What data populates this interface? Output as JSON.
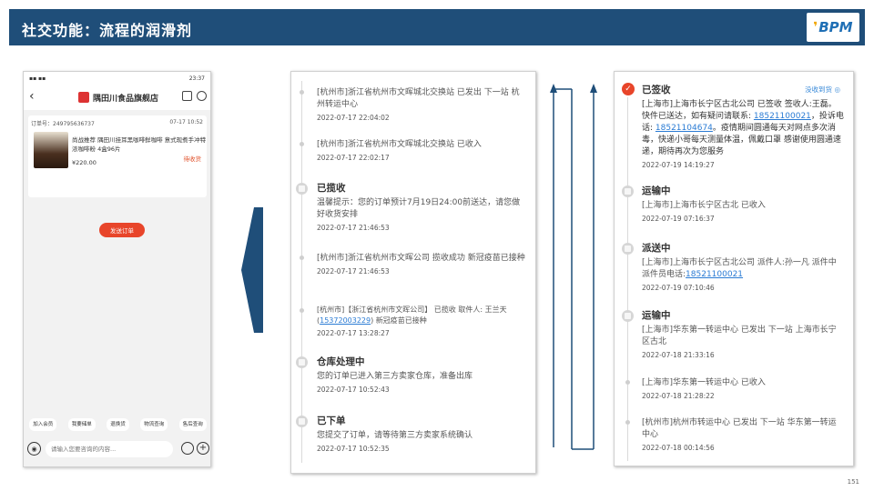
{
  "header": {
    "title": "社交功能：流程的润滑剂",
    "logo_mark": "❜",
    "logo_text": "BPM"
  },
  "phone": {
    "status_left": "▪▪ ▪▪",
    "status_right": "23:37",
    "back_glyph": "‹",
    "shop_name": "隅田川食品旗舰店",
    "order_no": "订单号：249795636737",
    "order_time": "07-17 10:52",
    "product_name": "尚战推荐  隅田川挂耳黑咖啡鲜咖啡 意式现煮手冲特浓咖啡粉  4盒96片",
    "product_price": "¥220.00",
    "product_status": "待收货",
    "send_button": "发送订单",
    "quick_actions": [
      "加入会员",
      "我要储单",
      "退换货",
      "物流查询",
      "售后查询"
    ],
    "input_placeholder": "请输入您要咨询的内容...",
    "voice_glyph": "◉",
    "plus_glyph": "+"
  },
  "mid_panel": {
    "events": [
      {
        "text": "[杭州市]浙江省杭州市文晖城北交换站 已发出 下一站 杭州转运中心",
        "time": "2022-07-17 22:04:02"
      },
      {
        "text": "[杭州市]浙江省杭州市文晖城北交换站 已收入",
        "time": "2022-07-17 22:02:17"
      },
      {
        "title": "已揽收",
        "text": "温馨提示：您的订单预计7月19日24:00前送达，请您做好收货安排",
        "time": "2022-07-17 21:46:53"
      },
      {
        "text": "[杭州市]浙江省杭州市文晖公司 揽收成功 新冠疫苗已接种",
        "time": "2022-07-17 21:46:53"
      },
      {
        "text_a": "[杭州市]【浙江省杭州市文晖公司】 已揽收 取件人: 王兰天(",
        "phone": "15372003229",
        "text_b": ") 新冠疫苗已接种",
        "time": "2022-07-17 13:28:27"
      },
      {
        "title": "仓库处理中",
        "text": "您的订单已进入第三方卖家仓库，准备出库",
        "time": "2022-07-17 10:52:43"
      },
      {
        "title": "已下单",
        "text": "您提交了订单，请等待第三方卖家系统确认",
        "time": "2022-07-17 10:52:35"
      }
    ]
  },
  "right_panel": {
    "link_text": "没收到货 ◎",
    "check_glyph": "✓",
    "events": [
      {
        "title": "已签收",
        "text_a": "[上海市]上海市长宁区古北公司 已签收  签收人:王磊。快件已送达，如有疑问请联系: ",
        "phone1": "18521100021",
        "text_b": "，投诉电话: ",
        "phone2": "18521104674",
        "text_c": "。疫情期间圆通每天对网点多次消毒，快递小哥每天测量体温，佩戴口罩 感谢使用圆通速递，期待再次为您服务",
        "time": "2022-07-19 14:19:27"
      },
      {
        "title": "运输中",
        "text": "[上海市]上海市长宁区古北 已收入",
        "time": "2022-07-19 07:16:37"
      },
      {
        "title": "派送中",
        "text_a": "[上海市]上海市长宁区古北公司 派件人:孙一凡 派件中 派件员电话:",
        "phone": "18521100021",
        "time": "2022-07-19 07:10:46"
      },
      {
        "title": "运输中",
        "text": "[上海市]华东第一转运中心 已发出 下一站  上海市长宁区古北",
        "time": "2022-07-18 21:33:16"
      },
      {
        "text": "[上海市]华东第一转运中心 已收入",
        "time": "2022-07-18 21:28:22"
      },
      {
        "text": "[杭州市]杭州市转运中心 已发出 下一站  华东第一转运中心",
        "time": "2022-07-18 00:14:56"
      }
    ]
  },
  "page_number": "151",
  "colors": {
    "header_bg": "#1f4e79",
    "accent_red": "#e8452a",
    "link_blue": "#2a7bd4",
    "arrow": "#1f4e79"
  }
}
